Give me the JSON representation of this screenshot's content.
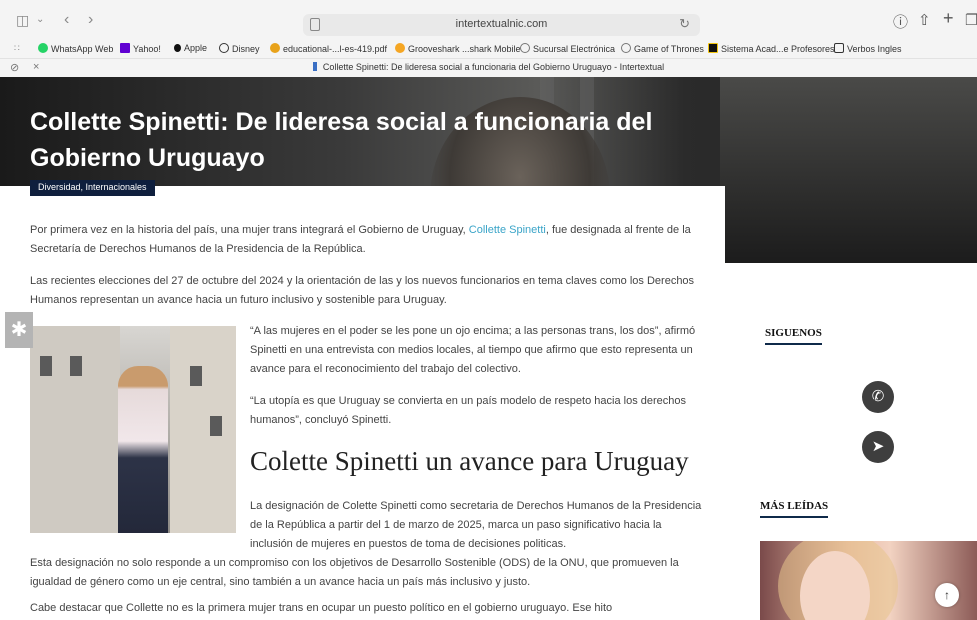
{
  "browser": {
    "url": "intertextualnic.com",
    "tab_title": "Collette Spinetti: De lideresa social a funcionaria del Gobierno Uruguayo - Intertextual",
    "bookmarks": [
      {
        "label": "WhatsApp Web",
        "icon": "whatsapp-icon",
        "color": "#25d366"
      },
      {
        "label": "Yahoo!",
        "icon": "yahoo-icon",
        "color": "#6001d2"
      },
      {
        "label": "Apple",
        "icon": "apple-icon",
        "color": "#000000"
      },
      {
        "label": "Disney",
        "icon": "disney-icon",
        "color": "#333333"
      },
      {
        "label": "educational-...l-es-419.pdf",
        "icon": "pdf-icon",
        "color": "#e8a21a"
      },
      {
        "label": "Grooveshark ...shark Mobile",
        "icon": "grooveshark-icon",
        "color": "#f5a623"
      },
      {
        "label": "Sucursal Electrónica",
        "icon": "globe-icon",
        "color": "#777777"
      },
      {
        "label": "Game of Thrones",
        "icon": "globe-icon",
        "color": "#777777"
      },
      {
        "label": "Sistema Acad...e Profesores",
        "icon": "sistema-icon",
        "color": "#f1c40f"
      },
      {
        "label": "Verbos Ingles",
        "icon": "verbos-icon",
        "color": "#333333"
      }
    ]
  },
  "article": {
    "title": "Collette Spinetti: De lideresa social a funcionaria del Gobierno Uruguayo",
    "category": "Diversidad, Internacionales",
    "p1_before": "Por primera vez en la historia del país, una mujer trans integrará el Gobierno de Uruguay, ",
    "p1_link": "Collette Spinetti",
    "p1_after": ", fue designada al frente de la Secretaría de Derechos Humanos de la Presidencia de la República.",
    "p2": "Las recientes elecciones del 27 de octubre del 2024 y la orientación de las y los nuevos funcionarios en tema claves como los Derechos Humanos representan un avance hacia un futuro inclusivo y sostenible para Uruguay.",
    "p3": "“A las mujeres en el poder se les pone un ojo encima; a las personas trans, los dos”, afirmó Spinetti en una entrevista con medios locales, al tiempo que afirmo que esto representa un avance para el reconocimiento del trabajo del colectivo.",
    "p4": "“La utopía es que Uruguay se convierta en un país modelo de respeto hacia los derechos humanos”, concluyó Spinetti.",
    "subheading": "Colette Spinetti un avance para Uruguay",
    "p5a": "La designación de Colette Spinetti como secretaria de Derechos Humanos de la Presidencia de la República a partir del 1 de marzo de 2025, marca un paso significativo hacia la inclusión de mujeres en puestos de toma de decisiones politicas.",
    "p5b": "Esta designación no solo responde a un compromiso con los objetivos de Desarrollo Sostenible (ODS) de la ONU, que promueven la igualdad de género como un eje central, sino también a un avance hacia un país más inclusivo y justo.",
    "p6": "Cabe destacar que Collette no es la primera mujer trans en ocupar un puesto político en el gobierno uruguayo. Ese hito"
  },
  "sidebar": {
    "follow_heading": "SIGUENOS",
    "most_read_heading": "MÁS LEÍDAS"
  },
  "colors": {
    "accent": "#0f1f3d",
    "link": "#3aa4c8"
  }
}
